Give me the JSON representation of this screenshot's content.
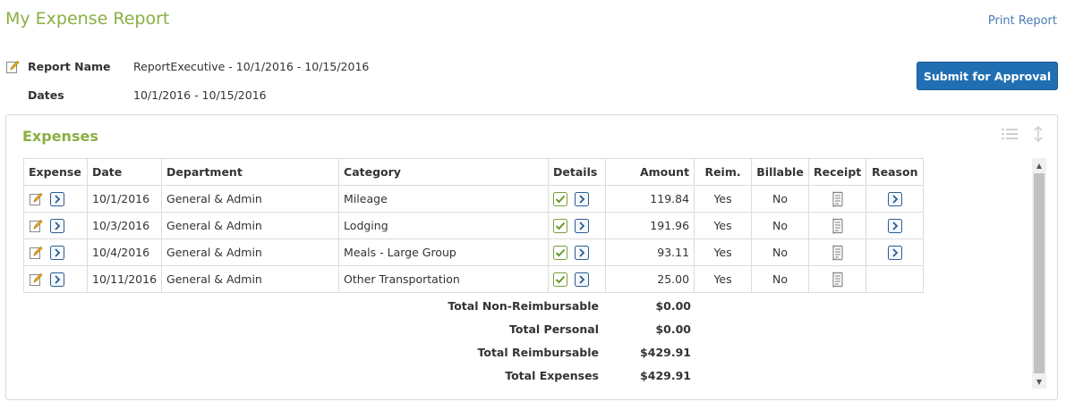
{
  "header": {
    "title": "My Expense Report",
    "print_label": "Print Report"
  },
  "report": {
    "name_label": "Report Name",
    "name_value": "ReportExecutive - 10/1/2016 - 10/15/2016",
    "dates_label": "Dates",
    "dates_value": "10/1/2016 - 10/15/2016",
    "submit_label": "Submit for Approval"
  },
  "expenses": {
    "title": "Expenses",
    "columns": [
      "Expense",
      "Date",
      "Department",
      "Category",
      "Details",
      "Amount",
      "Reim.",
      "Billable",
      "Receipt",
      "Reason"
    ],
    "rows": [
      {
        "date": "10/1/2016",
        "department": "General & Admin",
        "category": "Mileage",
        "amount": "119.84",
        "reim": "Yes",
        "billable": "No",
        "has_receipt": true,
        "has_reason": true
      },
      {
        "date": "10/3/2016",
        "department": "General & Admin",
        "category": "Lodging",
        "amount": "191.96",
        "reim": "Yes",
        "billable": "No",
        "has_receipt": true,
        "has_reason": true
      },
      {
        "date": "10/4/2016",
        "department": "General & Admin",
        "category": "Meals - Large Group",
        "amount": "93.11",
        "reim": "Yes",
        "billable": "No",
        "has_receipt": true,
        "has_reason": true
      },
      {
        "date": "10/11/2016",
        "department": "General & Admin",
        "category": "Other Transportation",
        "amount": "25.00",
        "reim": "Yes",
        "billable": "No",
        "has_receipt": true,
        "has_reason": false
      }
    ],
    "totals": [
      {
        "label": "Total Non-Reimbursable",
        "value": "$0.00"
      },
      {
        "label": "Total Personal",
        "value": "$0.00"
      },
      {
        "label": "Total Reimbursable",
        "value": "$429.91"
      },
      {
        "label": "Total Expenses",
        "value": "$429.91"
      }
    ]
  },
  "icons": {
    "edit": "edit-icon",
    "arrow": "chevron-right-icon",
    "check": "checkbox-checked-icon",
    "receipt": "receipt-icon",
    "list": "list-icon",
    "sort": "sort-icon"
  },
  "colors": {
    "accent_green": "#8ab042",
    "link_blue": "#4a7cb3",
    "button_blue": "#1f6fb2"
  }
}
